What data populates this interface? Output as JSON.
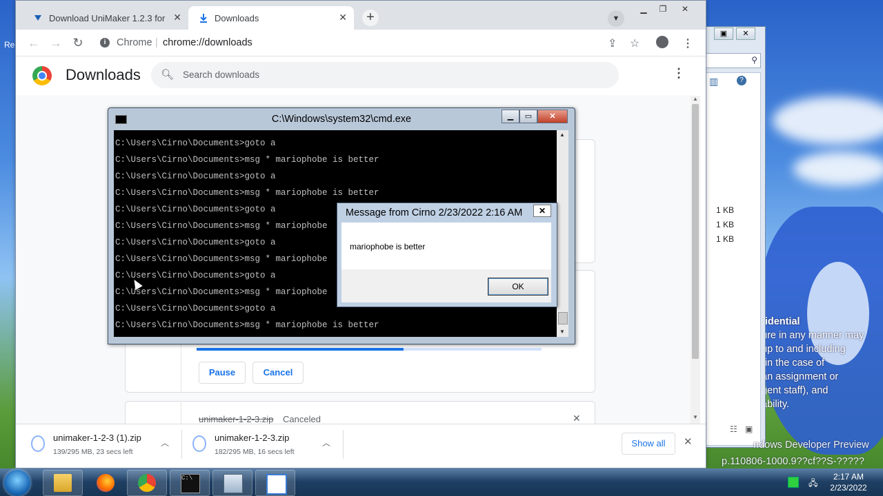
{
  "desktop": {
    "edge_text": "Re",
    "confidential_lines": [
      "fidential",
      "ure in any manner may",
      "up to and including",
      "(in the case of",
      "an assignment or",
      "gent staff), and",
      "ability."
    ],
    "watermark_lines": [
      "ndows Developer Preview",
      "p.110806-1000.9??cf??S-?????"
    ]
  },
  "explorer": {
    "sizes": [
      "1 KB",
      "1 KB",
      "1 KB"
    ]
  },
  "chrome": {
    "tabs": [
      {
        "label": "Download UniMaker 1.2.3 for Wi",
        "active": false
      },
      {
        "label": "Downloads",
        "active": true
      }
    ],
    "address": {
      "site": "Chrome",
      "separator": "|",
      "url": "chrome://downloads"
    },
    "page": {
      "title": "Downloads",
      "search_placeholder": "Search downloads",
      "pause_label": "Pause",
      "cancel_label": "Cancel",
      "canceled_file": "unimaker-1-2-3.zip",
      "canceled_status": "Canceled",
      "progress": 0.6
    },
    "shelf": {
      "items": [
        {
          "name": "unimaker-1-2-3 (1).zip",
          "status": "139/295 MB, 23 secs left"
        },
        {
          "name": "unimaker-1-2-3.zip",
          "status": "182/295 MB, 16 secs left"
        }
      ],
      "show_all": "Show all"
    }
  },
  "cmd": {
    "title": "C:\\Windows\\system32\\cmd.exe",
    "lines": [
      "C:\\Users\\Cirno\\Documents>goto a",
      "C:\\Users\\Cirno\\Documents>msg * mariophobe is better",
      "C:\\Users\\Cirno\\Documents>goto a",
      "C:\\Users\\Cirno\\Documents>msg * mariophobe is better",
      "C:\\Users\\Cirno\\Documents>goto a",
      "C:\\Users\\Cirno\\Documents>msg * mariophobe",
      "C:\\Users\\Cirno\\Documents>goto a",
      "C:\\Users\\Cirno\\Documents>msg * mariophobe",
      "C:\\Users\\Cirno\\Documents>goto a",
      "C:\\Users\\Cirno\\Documents>msg * mariophobe",
      "C:\\Users\\Cirno\\Documents>goto a",
      "C:\\Users\\Cirno\\Documents>msg * mariophobe is better"
    ]
  },
  "message_box": {
    "title": "Message from Cirno 2/23/2022 2:16 AM",
    "text": "mariophobe is better",
    "ok_label": "OK"
  },
  "taskbar": {
    "apps": [
      "file-explorer",
      "firefox",
      "chrome",
      "cmd",
      "control-panel",
      "notepad"
    ],
    "time": "2:17 AM",
    "date": "2/23/2022"
  }
}
